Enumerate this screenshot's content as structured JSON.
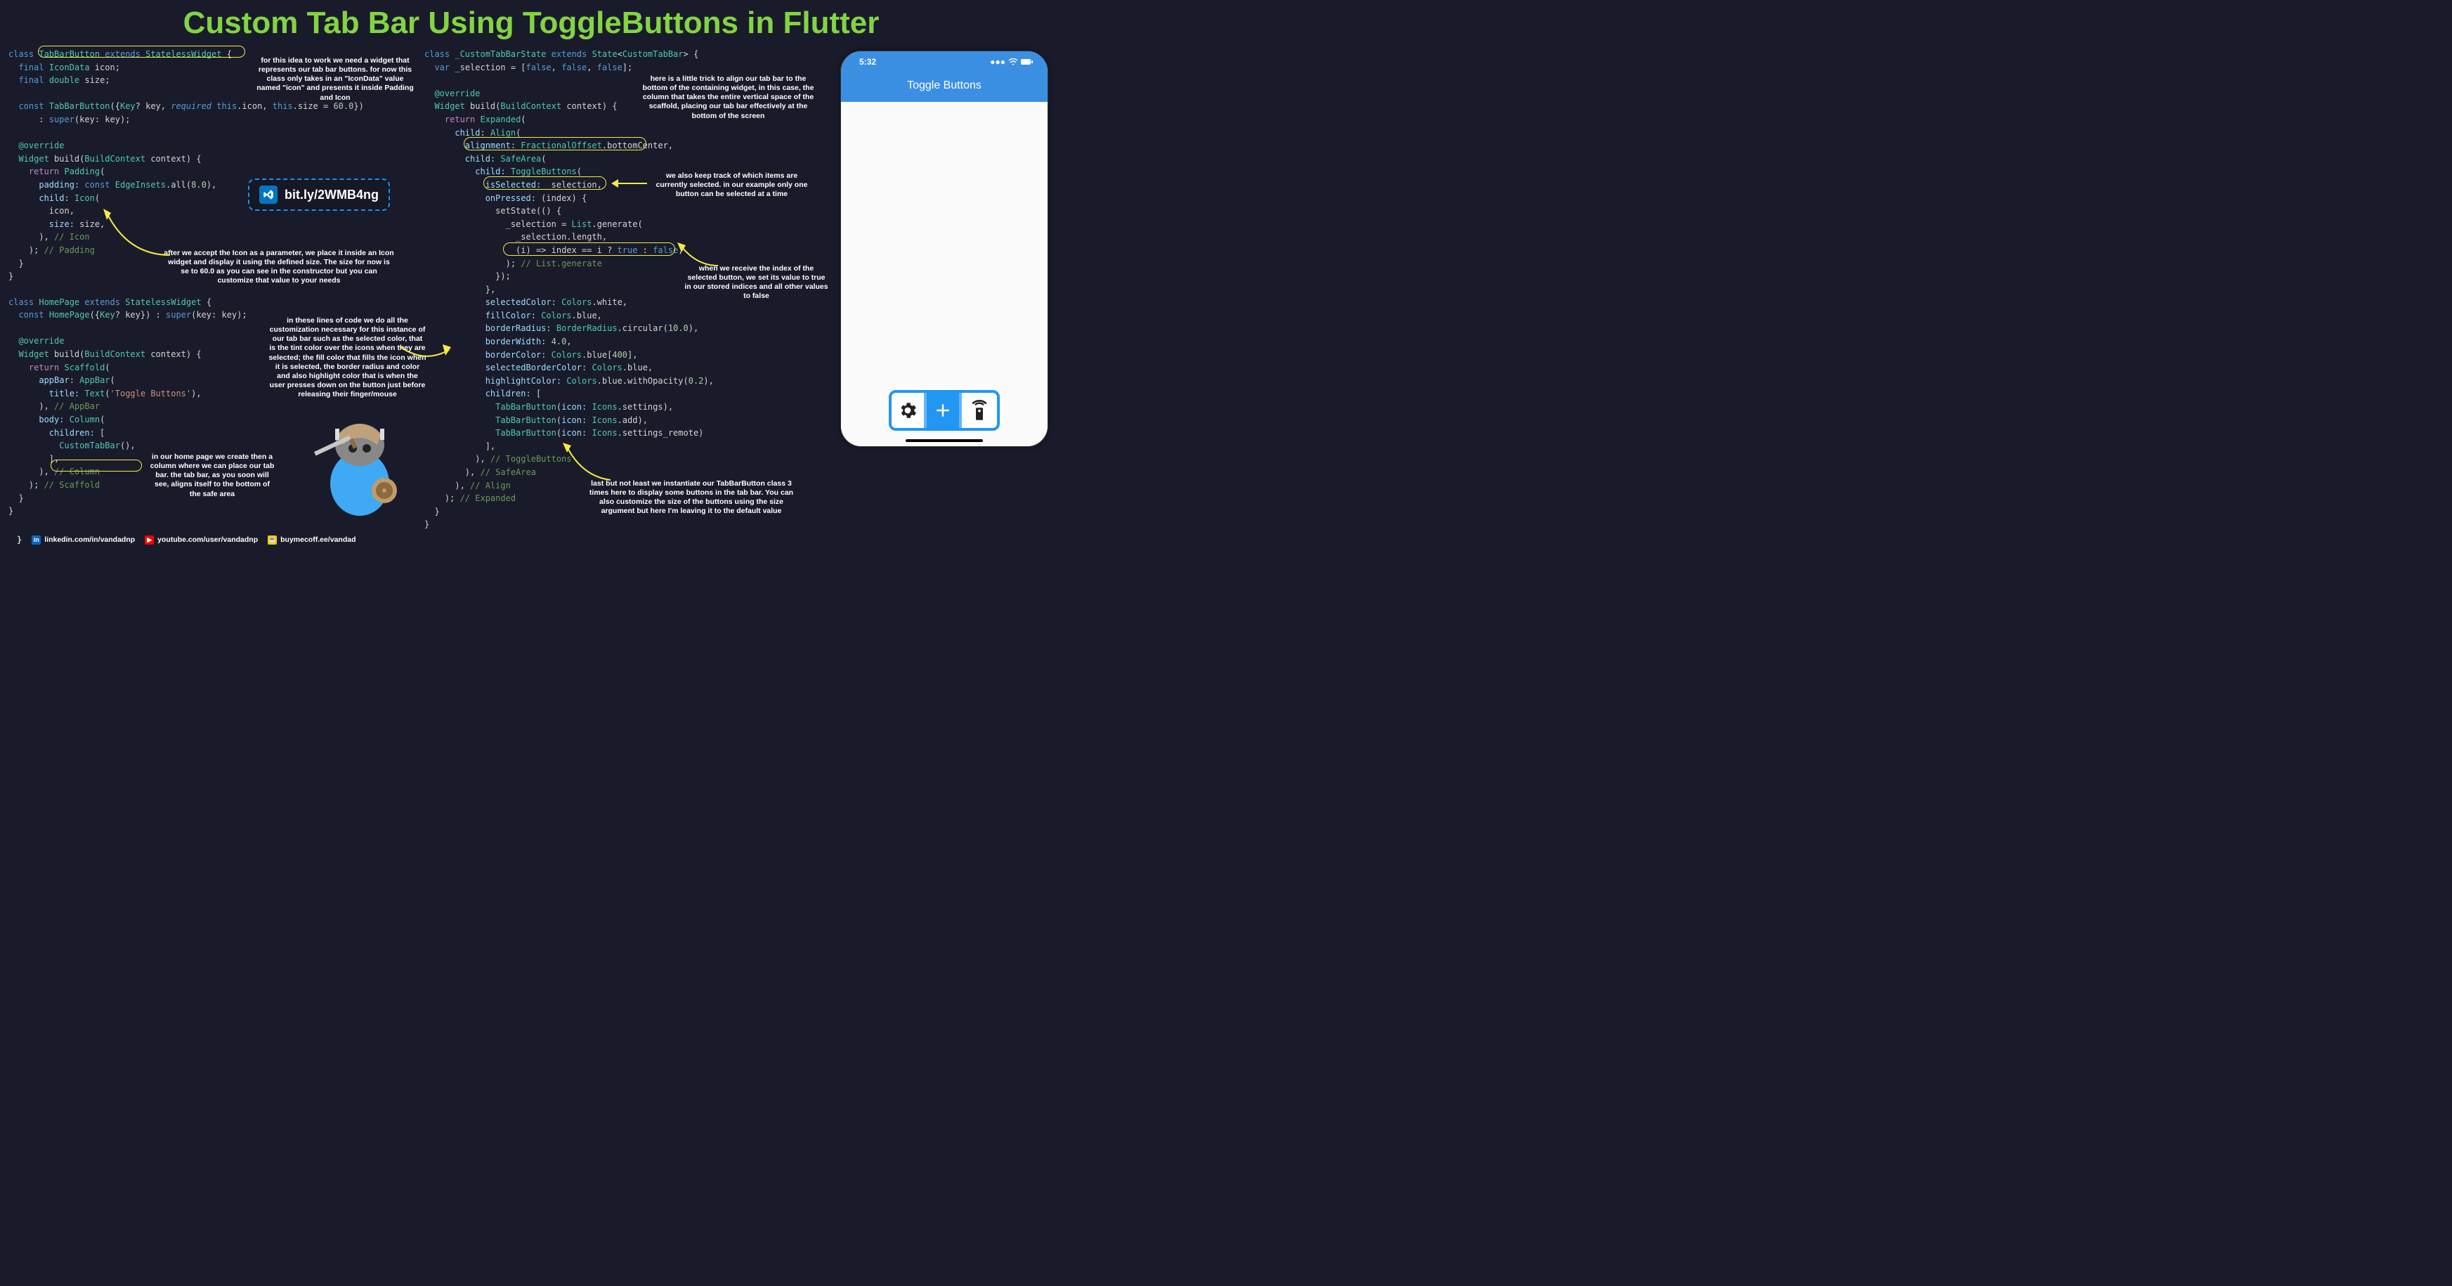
{
  "title": "Custom Tab Bar Using ToggleButtons in Flutter",
  "link_pill": "bit.ly/2WMB4ng",
  "annotations": {
    "a1": "for this idea to work we need a widget that represents our tab bar buttons. for now this class only takes in an \"IconData\" value named \"icon\" and presents it inside Padding and Icon",
    "a2": "after we accept the Icon as a parameter, we place it inside an Icon widget and display it using the defined size. The size for now is se to 60.0 as you can see in the constructor but you can customize that value to your needs",
    "a3": "in these lines of code we do all the customization necessary for this instance of our tab bar such as the selected color, that is the tint color over the icons when they are selected; the fill color that fills the icon when it is selected, the border radius and color and also highlight color that is when the user presses down on the button just before releasing their finger/mouse",
    "a4": "in our home page we create then a column where we can place our tab bar. the tab bar, as you soon will see, aligns itself to the bottom of the safe area",
    "a5": "here is a little trick to align our tab bar to the bottom of the containing widget, in this case, the column that takes the entire vertical space of the scaffold, placing our tab bar effectively at the bottom of the screen",
    "a6": "we also keep track of which items are currently selected. in our example only one button can be selected at a time",
    "a7": "when we receive the index of the selected button, we set its value to true in our stored indices and all other values to false",
    "a8": "last but not least we instantiate our TabBarButton class 3 times here to display some buttons in the tab bar. You can also customize the size of the buttons using the size argument but here I'm leaving it to the default value"
  },
  "phone": {
    "time": "5:32",
    "appbar_title": "Toggle Buttons"
  },
  "footer": {
    "linkedin": "linkedin.com/in/vandadnp",
    "youtube": "youtube.com/user/vandadnp",
    "buymecoffee": "buymecoff.ee/vandad"
  },
  "code_left_1": "class TabBarButton extends StatelessWidget {\n  final IconData icon;\n  final double size;\n\n  const TabBarButton({Key? key, required this.icon, this.size = 60.0})\n      : super(key: key);\n\n  @override\n  Widget build(BuildContext context) {\n    return Padding(\n      padding: const EdgeInsets.all(8.0),\n      child: Icon(\n        icon,\n        size: size,\n      ), // Icon\n    ); // Padding\n  }\n}",
  "code_left_2": "class HomePage extends StatelessWidget {\n  const HomePage({Key? key}) : super(key: key);\n\n  @override\n  Widget build(BuildContext context) {\n    return Scaffold(\n      appBar: AppBar(\n        title: Text('Toggle Buttons'),\n      ), // AppBar\n      body: Column(\n        children: [\n          CustomTabBar(),\n        ],\n      ), // Column\n    ); // Scaffold\n  }\n}",
  "code_right": "class _CustomTabBarState extends State<CustomTabBar> {\n  var _selection = [false, false, false];\n\n  @override\n  Widget build(BuildContext context) {\n    return Expanded(\n      child: Align(\n        alignment: FractionalOffset.bottomCenter,\n        child: SafeArea(\n          child: ToggleButtons(\n            isSelected: _selection,\n            onPressed: (index) {\n              setState(() {\n                _selection = List.generate(\n                  _selection.length,\n                  (i) => index == i ? true : false,\n                ); // List.generate\n              });\n            },\n            selectedColor: Colors.white,\n            fillColor: Colors.blue,\n            borderRadius: BorderRadius.circular(10.0),\n            borderWidth: 4.0,\n            borderColor: Colors.blue[400],\n            selectedBorderColor: Colors.blue,\n            highlightColor: Colors.blue.withOpacity(0.2),\n            children: [\n              TabBarButton(icon: Icons.settings),\n              TabBarButton(icon: Icons.add),\n              TabBarButton(icon: Icons.settings_remote)\n            ],\n          ), // ToggleButtons\n        ), // SafeArea\n      ), // Align\n    ); // Expanded\n  }\n}"
}
